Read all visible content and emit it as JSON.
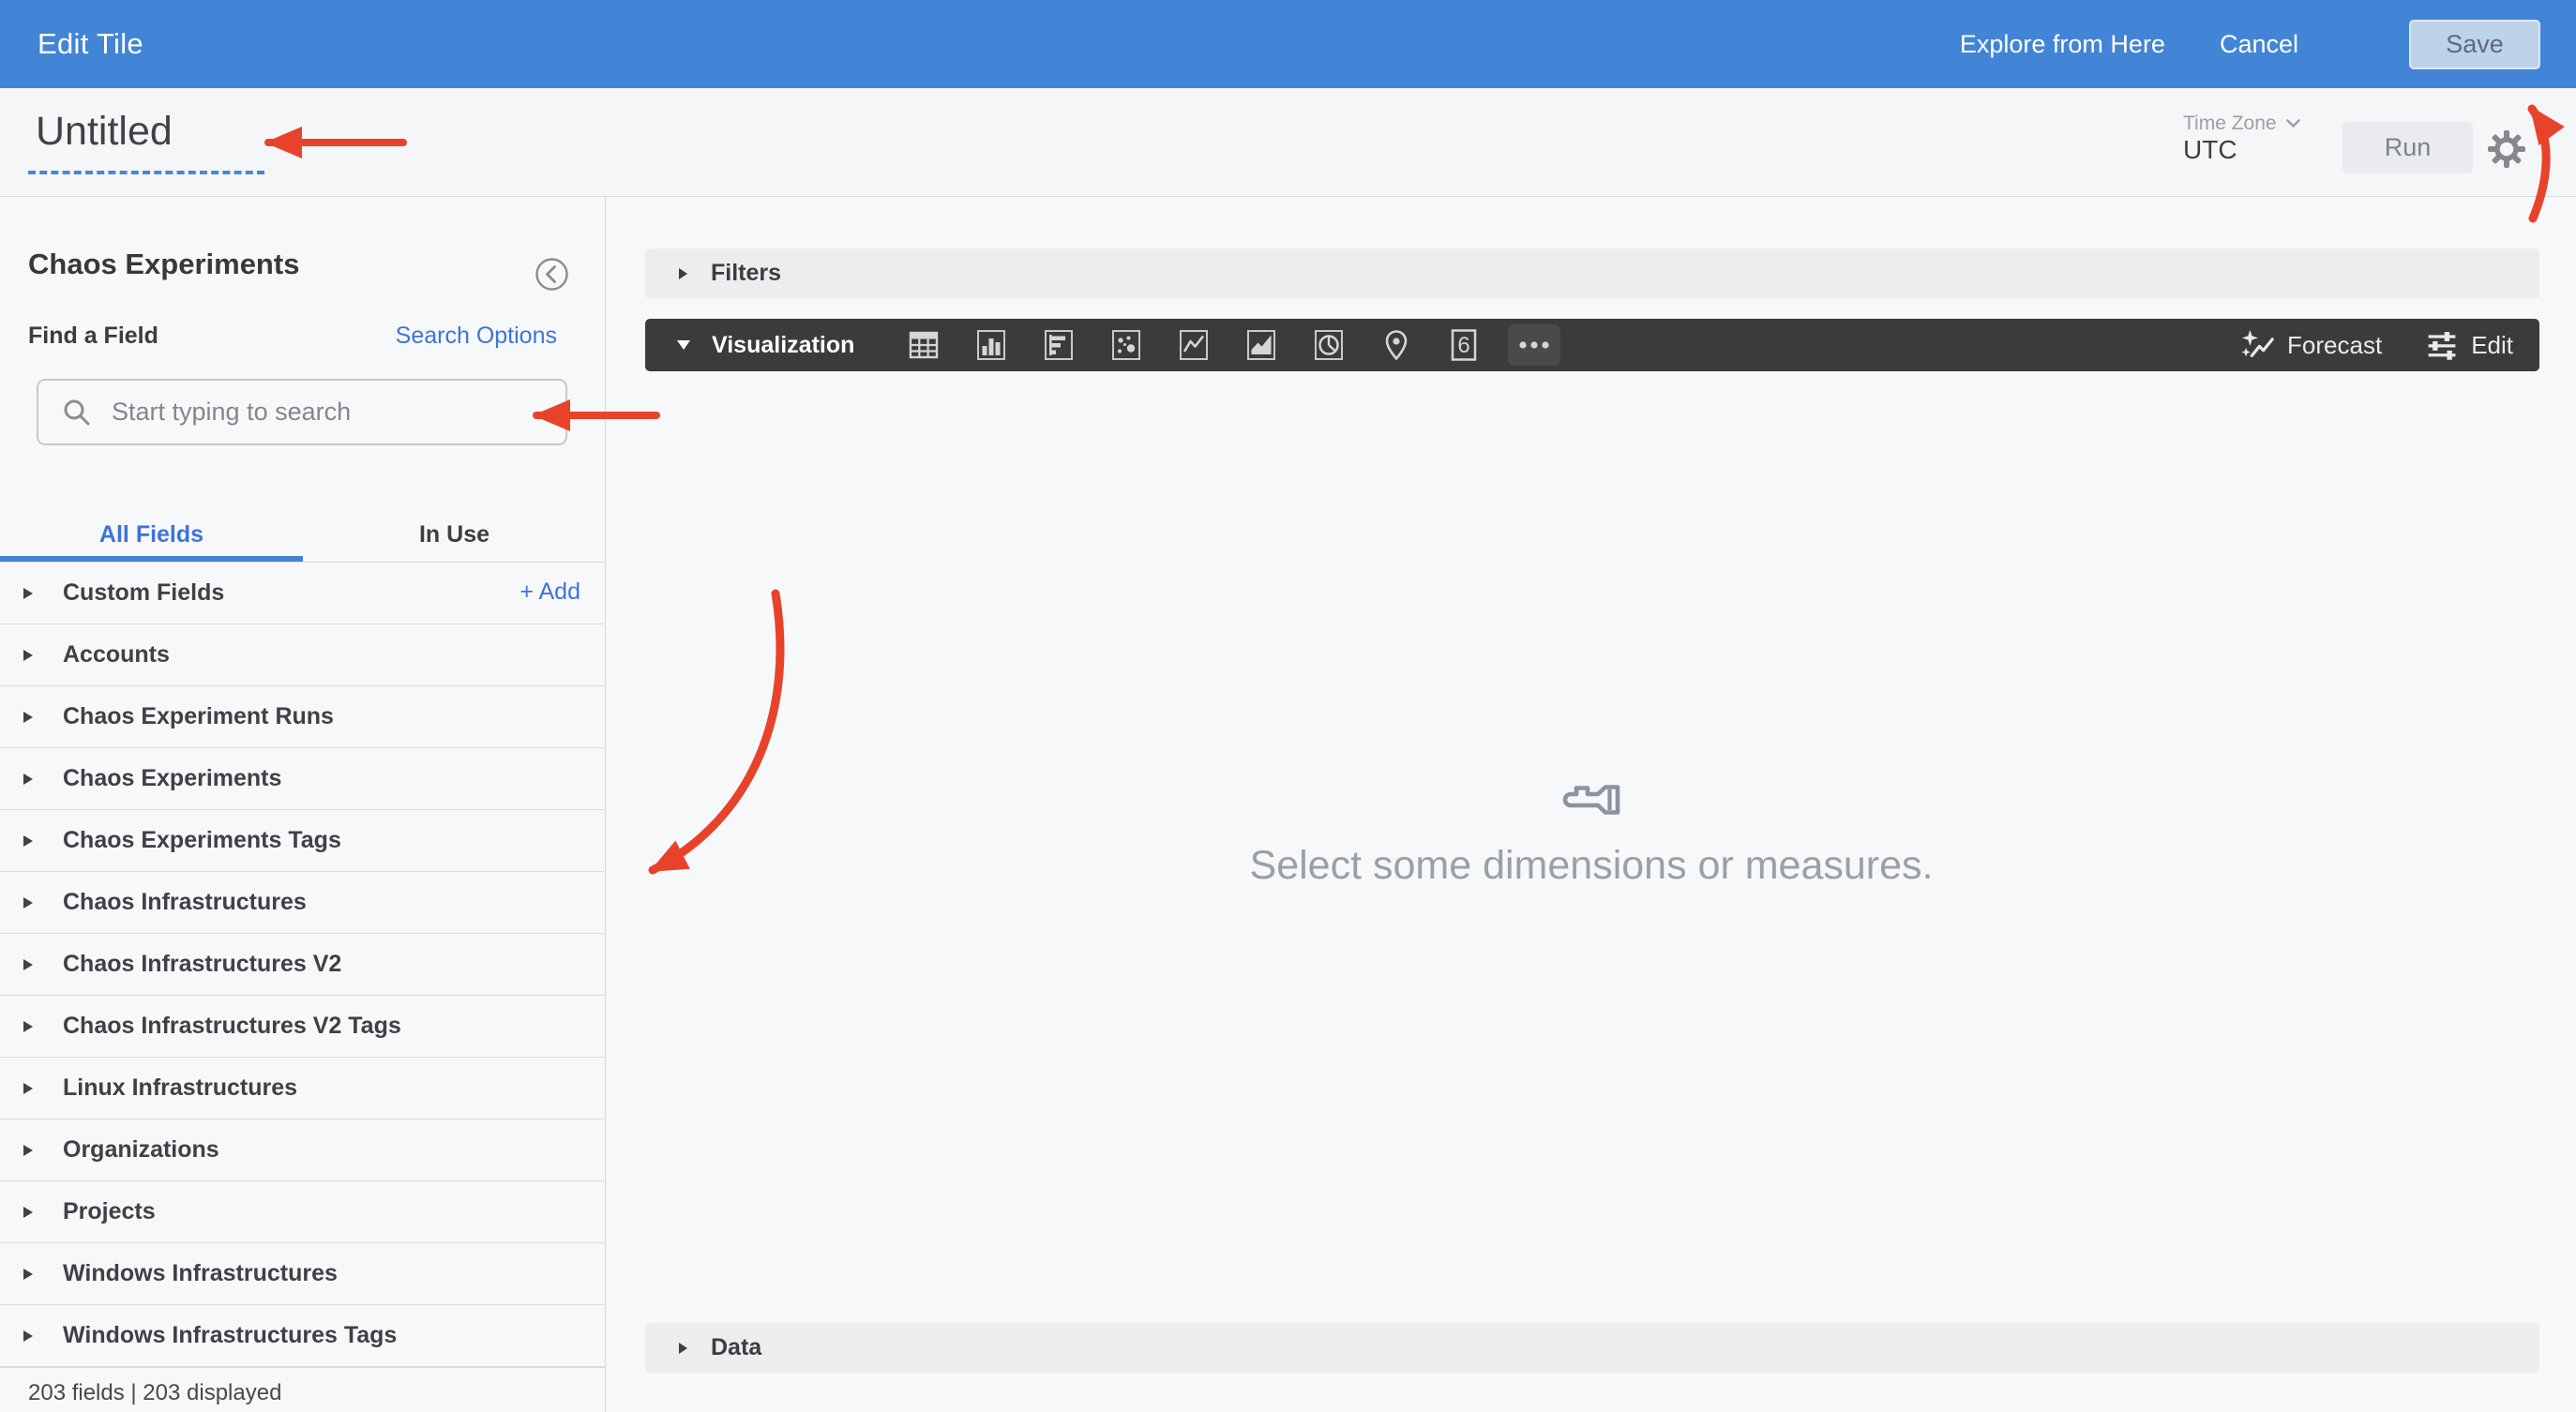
{
  "colors": {
    "topbar_blue": "#4284d6",
    "accent_blue": "#3d74da",
    "tab_underline": "#4285d0",
    "dark_bar": "#3b3b3d",
    "annotation_red": "#e8432a",
    "save_button_bg": "#bdd3ec"
  },
  "topbar": {
    "title": "Edit Tile",
    "explore_label": "Explore from Here",
    "cancel_label": "Cancel",
    "save_label": "Save"
  },
  "header": {
    "tile_title": "Untitled",
    "timezone_label": "Time Zone",
    "timezone_value": "UTC",
    "run_label": "Run"
  },
  "sidebar": {
    "title": "Chaos Experiments",
    "find_field_label": "Find a Field",
    "search_options_label": "Search Options",
    "search_placeholder": "Start typing to search",
    "search_value": "",
    "tabs": [
      {
        "label": "All Fields",
        "active": true
      },
      {
        "label": "In Use",
        "active": false
      }
    ],
    "add_label": "+ Add",
    "fields": [
      {
        "label": "Custom Fields",
        "has_add": true
      },
      {
        "label": "Accounts"
      },
      {
        "label": "Chaos Experiment Runs"
      },
      {
        "label": "Chaos Experiments"
      },
      {
        "label": "Chaos Experiments Tags"
      },
      {
        "label": "Chaos Infrastructures"
      },
      {
        "label": "Chaos Infrastructures V2"
      },
      {
        "label": "Chaos Infrastructures V2 Tags"
      },
      {
        "label": "Linux Infrastructures"
      },
      {
        "label": "Organizations"
      },
      {
        "label": "Projects"
      },
      {
        "label": "Windows Infrastructures"
      },
      {
        "label": "Windows Infrastructures Tags"
      }
    ],
    "footer": "203 fields | 203 displayed"
  },
  "main": {
    "filters_label": "Filters",
    "visualization_label": "Visualization",
    "viz_icons": [
      "table-icon",
      "column-chart-icon",
      "bar-chart-icon",
      "scatter-chart-icon",
      "line-chart-icon",
      "area-chart-icon",
      "pie-chart-icon",
      "map-pin-icon",
      "single-value-icon",
      "more-icon"
    ],
    "single_value_glyph": "6",
    "forecast_label": "Forecast",
    "edit_label": "Edit",
    "empty_message": "Select some dimensions or measures.",
    "data_label": "Data"
  }
}
